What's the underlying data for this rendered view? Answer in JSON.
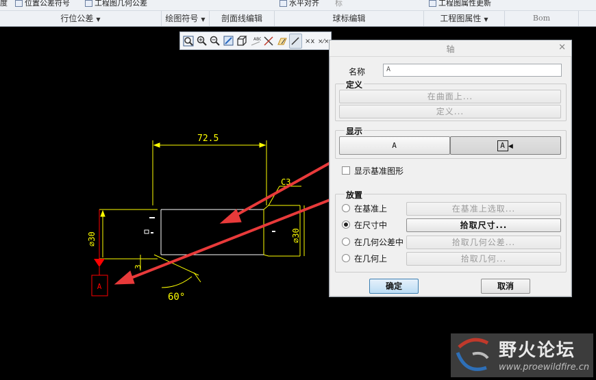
{
  "ribbon": {
    "top_items": {
      "fragment": "度",
      "position_tol_symbol": "位置公差符号",
      "geom_tol": "工程图几何公差",
      "horizontal_align": "水平对齐",
      "mark": "标",
      "drawing_attr_update": "工程图属性更新"
    },
    "groups": [
      {
        "label": "行位公差",
        "dropdown": true
      },
      {
        "label": "绘图符号",
        "dropdown": true
      },
      {
        "label": "剖面线编辑",
        "dropdown": false
      },
      {
        "label": "球标编辑",
        "dropdown": false
      },
      {
        "label": "工程图属性",
        "dropdown": true
      },
      {
        "label": "Bom",
        "dropdown": false
      }
    ]
  },
  "drawing": {
    "dim_length": "72.5",
    "dim_chamfer": "C3",
    "dim_diameter_right": "⌀30",
    "dim_diameter_left": "⌀30",
    "dim_angle": "60°",
    "dim_small": "3",
    "datum_label": "A",
    "colors": {
      "line": "#ffff00",
      "datum": "#ff0000",
      "arrow": "#ee3333",
      "white": "#ffffff"
    }
  },
  "dialog": {
    "title": "轴",
    "name_label": "名称",
    "name_value": "A",
    "define_section": "定义",
    "on_surface_btn": "在曲面上...",
    "define_btn": "定义...",
    "display_section": "显示",
    "display_option_a": "A",
    "display_option_b": "A",
    "show_datum_graphic": "显示基准图形",
    "placement_section": "放置",
    "placement": [
      {
        "label": "在基准上",
        "button": "在基准上选取...",
        "selected": false,
        "enabled": false
      },
      {
        "label": "在尺寸中",
        "button": "拾取尺寸...",
        "selected": true,
        "enabled": true
      },
      {
        "label": "在几何公差中",
        "button": "拾取几何公差...",
        "selected": false,
        "enabled": false
      },
      {
        "label": "在几何上",
        "button": "拾取几何...",
        "selected": false,
        "enabled": false
      }
    ],
    "ok": "确定",
    "cancel": "取消"
  },
  "watermark": {
    "title": "野火论坛",
    "url": "www.proewildfire.cn"
  }
}
